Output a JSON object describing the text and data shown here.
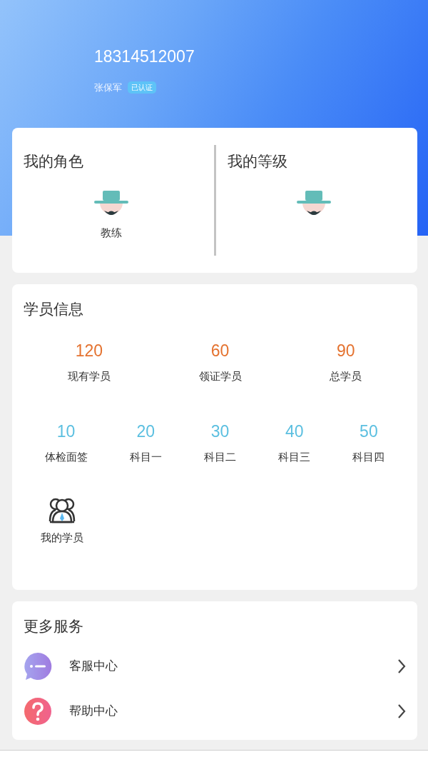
{
  "profile": {
    "phone": "18314512007",
    "name": "张保军",
    "badge": "已认证"
  },
  "role_card": {
    "panels": [
      {
        "title": "我的角色",
        "label": "教练"
      },
      {
        "title": "我的等级"
      }
    ]
  },
  "students": {
    "title": "学员信息",
    "totals": [
      {
        "value": "120",
        "label": "现有学员"
      },
      {
        "value": "60",
        "label": "领证学员"
      },
      {
        "value": "90",
        "label": "总学员"
      }
    ],
    "stages": [
      {
        "value": "10",
        "label": "体检面签"
      },
      {
        "value": "20",
        "label": "科目一"
      },
      {
        "value": "30",
        "label": "科目二"
      },
      {
        "value": "40",
        "label": "科目三"
      },
      {
        "value": "50",
        "label": "科目四"
      }
    ],
    "shortcut": {
      "label": "我的学员"
    }
  },
  "services": {
    "title": "更多服务",
    "items": [
      {
        "label": "客服中心",
        "kind": "chat"
      },
      {
        "label": "帮助中心",
        "kind": "help"
      }
    ]
  }
}
